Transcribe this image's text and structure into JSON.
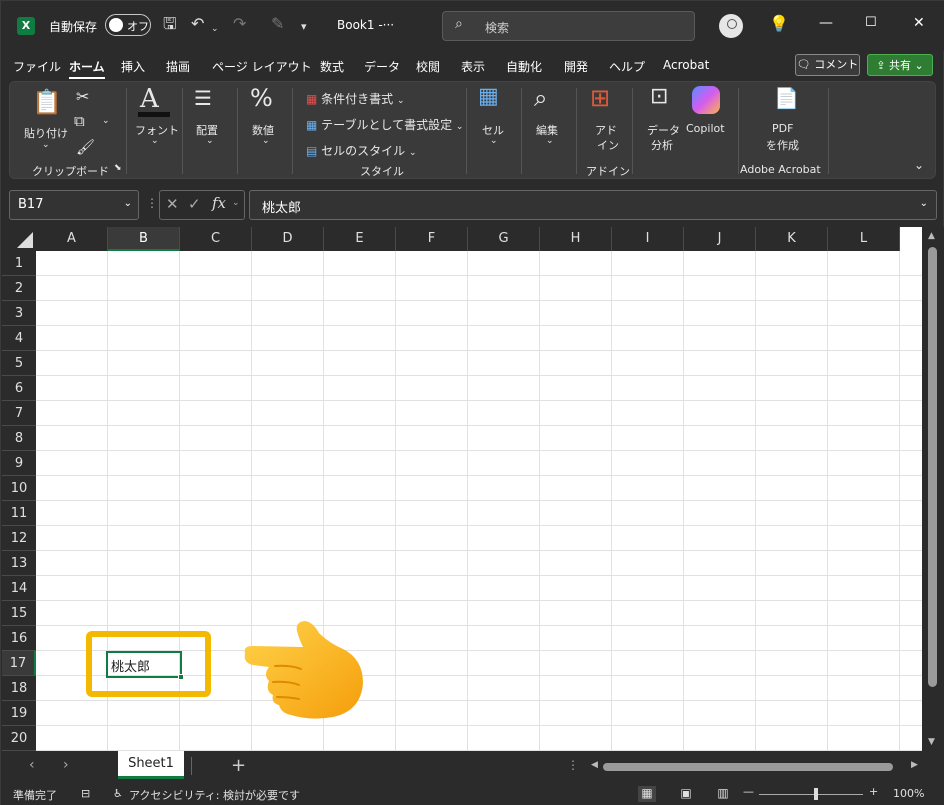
{
  "titlebar": {
    "autosave_label": "自動保存",
    "autosave_state": "オフ",
    "document_title": "Book1  -···",
    "search_placeholder": "検索"
  },
  "menu": {
    "tabs": [
      "ファイル",
      "ホーム",
      "挿入",
      "描画",
      "ページ レイアウト",
      "数式",
      "データ",
      "校閲",
      "表示",
      "自動化",
      "開発",
      "ヘルプ",
      "Acrobat"
    ],
    "active": "ホーム",
    "comment_label": "コメント",
    "share_label": "共有"
  },
  "ribbon": {
    "paste_label": "貼り付け",
    "clipboard_group": "クリップボード",
    "font_label": "フォント",
    "align_label": "配置",
    "number_label": "数値",
    "conditional_format": "条件付き書式",
    "table_format": "テーブルとして書式設定",
    "cell_styles": "セルのスタイル",
    "styles_group": "スタイル",
    "cells_label": "セル",
    "edit_label": "編集",
    "addin_label_1": "アド",
    "addin_label_2": "イン",
    "addin_group": "アドイン",
    "data_analysis_1": "データ",
    "data_analysis_2": "分析",
    "copilot_label": "Copilot",
    "pdf_label_1": "PDF",
    "pdf_label_2": "を作成",
    "acrobat_group": "Adobe Acrobat"
  },
  "formula_bar": {
    "name_box": "B17",
    "fx": "fx",
    "content": "桃太郎"
  },
  "grid": {
    "columns": [
      "A",
      "B",
      "C",
      "D",
      "E",
      "F",
      "G",
      "H",
      "I",
      "J",
      "K",
      "L"
    ],
    "rows": [
      "1",
      "2",
      "3",
      "4",
      "5",
      "6",
      "7",
      "8",
      "9",
      "10",
      "11",
      "12",
      "13",
      "14",
      "15",
      "16",
      "17",
      "18",
      "19",
      "20"
    ],
    "selected_column": "B",
    "selected_row": "17",
    "active_cell_value": "桃太郎"
  },
  "sheets": {
    "tabs": [
      "Sheet1"
    ],
    "add_label": "+"
  },
  "status": {
    "ready": "準備完了",
    "accessibility": "アクセシビリティ: 検討が必要です",
    "zoom": "100%"
  },
  "colors": {
    "excel_green": "#107c41",
    "highlight": "#f5b800",
    "share_green": "#2e7d32"
  }
}
